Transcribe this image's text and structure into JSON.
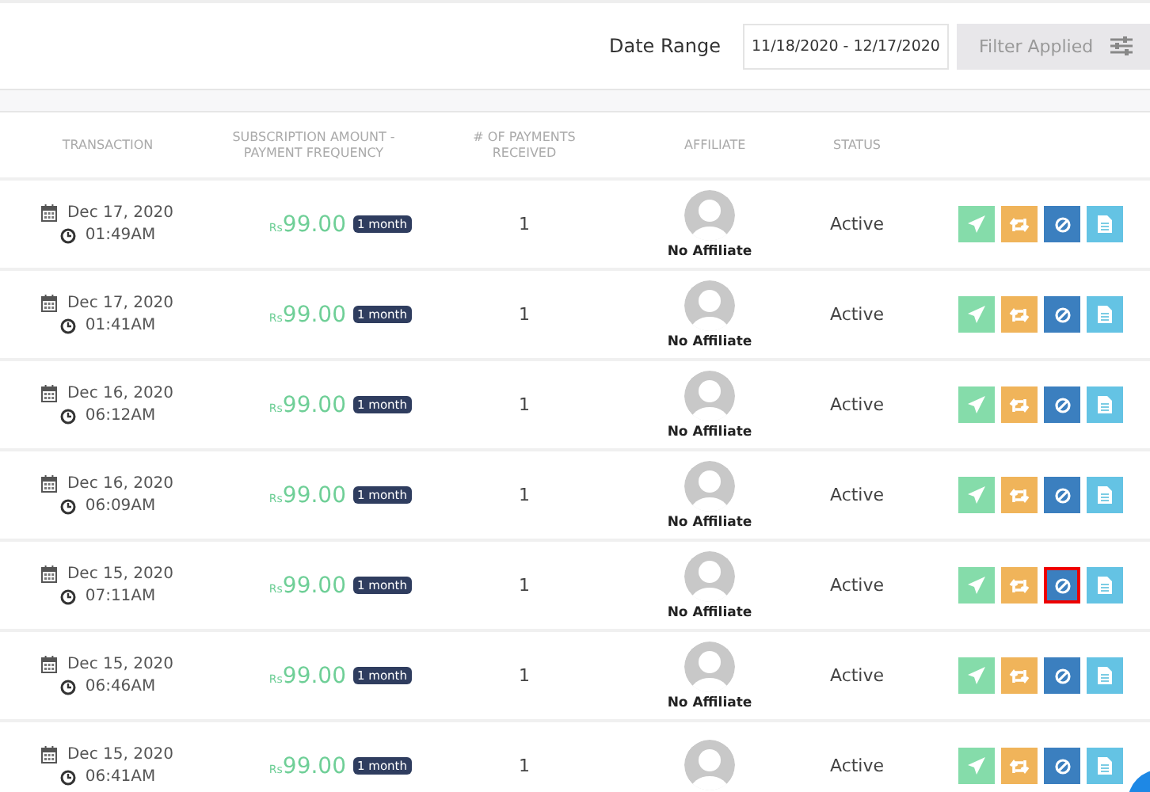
{
  "filter_bar": {
    "date_range_label": "Date Range",
    "date_range_value": "11/18/2020 - 12/17/2020",
    "filter_button": "Filter Applied"
  },
  "table": {
    "columns": [
      "TRANSACTION",
      "SUBSCRIPTION AMOUNT - PAYMENT FREQUENCY",
      "# OF PAYMENTS RECEIVED",
      "AFFILIATE",
      "STATUS"
    ],
    "rows": [
      {
        "date": "Dec 17, 2020",
        "time": "01:49AM",
        "currency": "Rs",
        "amount": "99.00",
        "frequency": "1 month",
        "payments": "1",
        "affiliate": "No Affiliate",
        "status": "Active",
        "cancel_highlighted": false
      },
      {
        "date": "Dec 17, 2020",
        "time": "01:41AM",
        "currency": "Rs",
        "amount": "99.00",
        "frequency": "1 month",
        "payments": "1",
        "affiliate": "No Affiliate",
        "status": "Active",
        "cancel_highlighted": false
      },
      {
        "date": "Dec 16, 2020",
        "time": "06:12AM",
        "currency": "Rs",
        "amount": "99.00",
        "frequency": "1 month",
        "payments": "1",
        "affiliate": "No Affiliate",
        "status": "Active",
        "cancel_highlighted": false
      },
      {
        "date": "Dec 16, 2020",
        "time": "06:09AM",
        "currency": "Rs",
        "amount": "99.00",
        "frequency": "1 month",
        "payments": "1",
        "affiliate": "No Affiliate",
        "status": "Active",
        "cancel_highlighted": false
      },
      {
        "date": "Dec 15, 2020",
        "time": "07:11AM",
        "currency": "Rs",
        "amount": "99.00",
        "frequency": "1 month",
        "payments": "1",
        "affiliate": "No Affiliate",
        "status": "Active",
        "cancel_highlighted": true
      },
      {
        "date": "Dec 15, 2020",
        "time": "06:46AM",
        "currency": "Rs",
        "amount": "99.00",
        "frequency": "1 month",
        "payments": "1",
        "affiliate": "No Affiliate",
        "status": "Active",
        "cancel_highlighted": false
      },
      {
        "date": "Dec 15, 2020",
        "time": "06:41AM",
        "currency": "Rs",
        "amount": "99.00",
        "frequency": "1 month",
        "payments": "1",
        "status": "Active",
        "cancel_highlighted": false
      }
    ]
  }
}
